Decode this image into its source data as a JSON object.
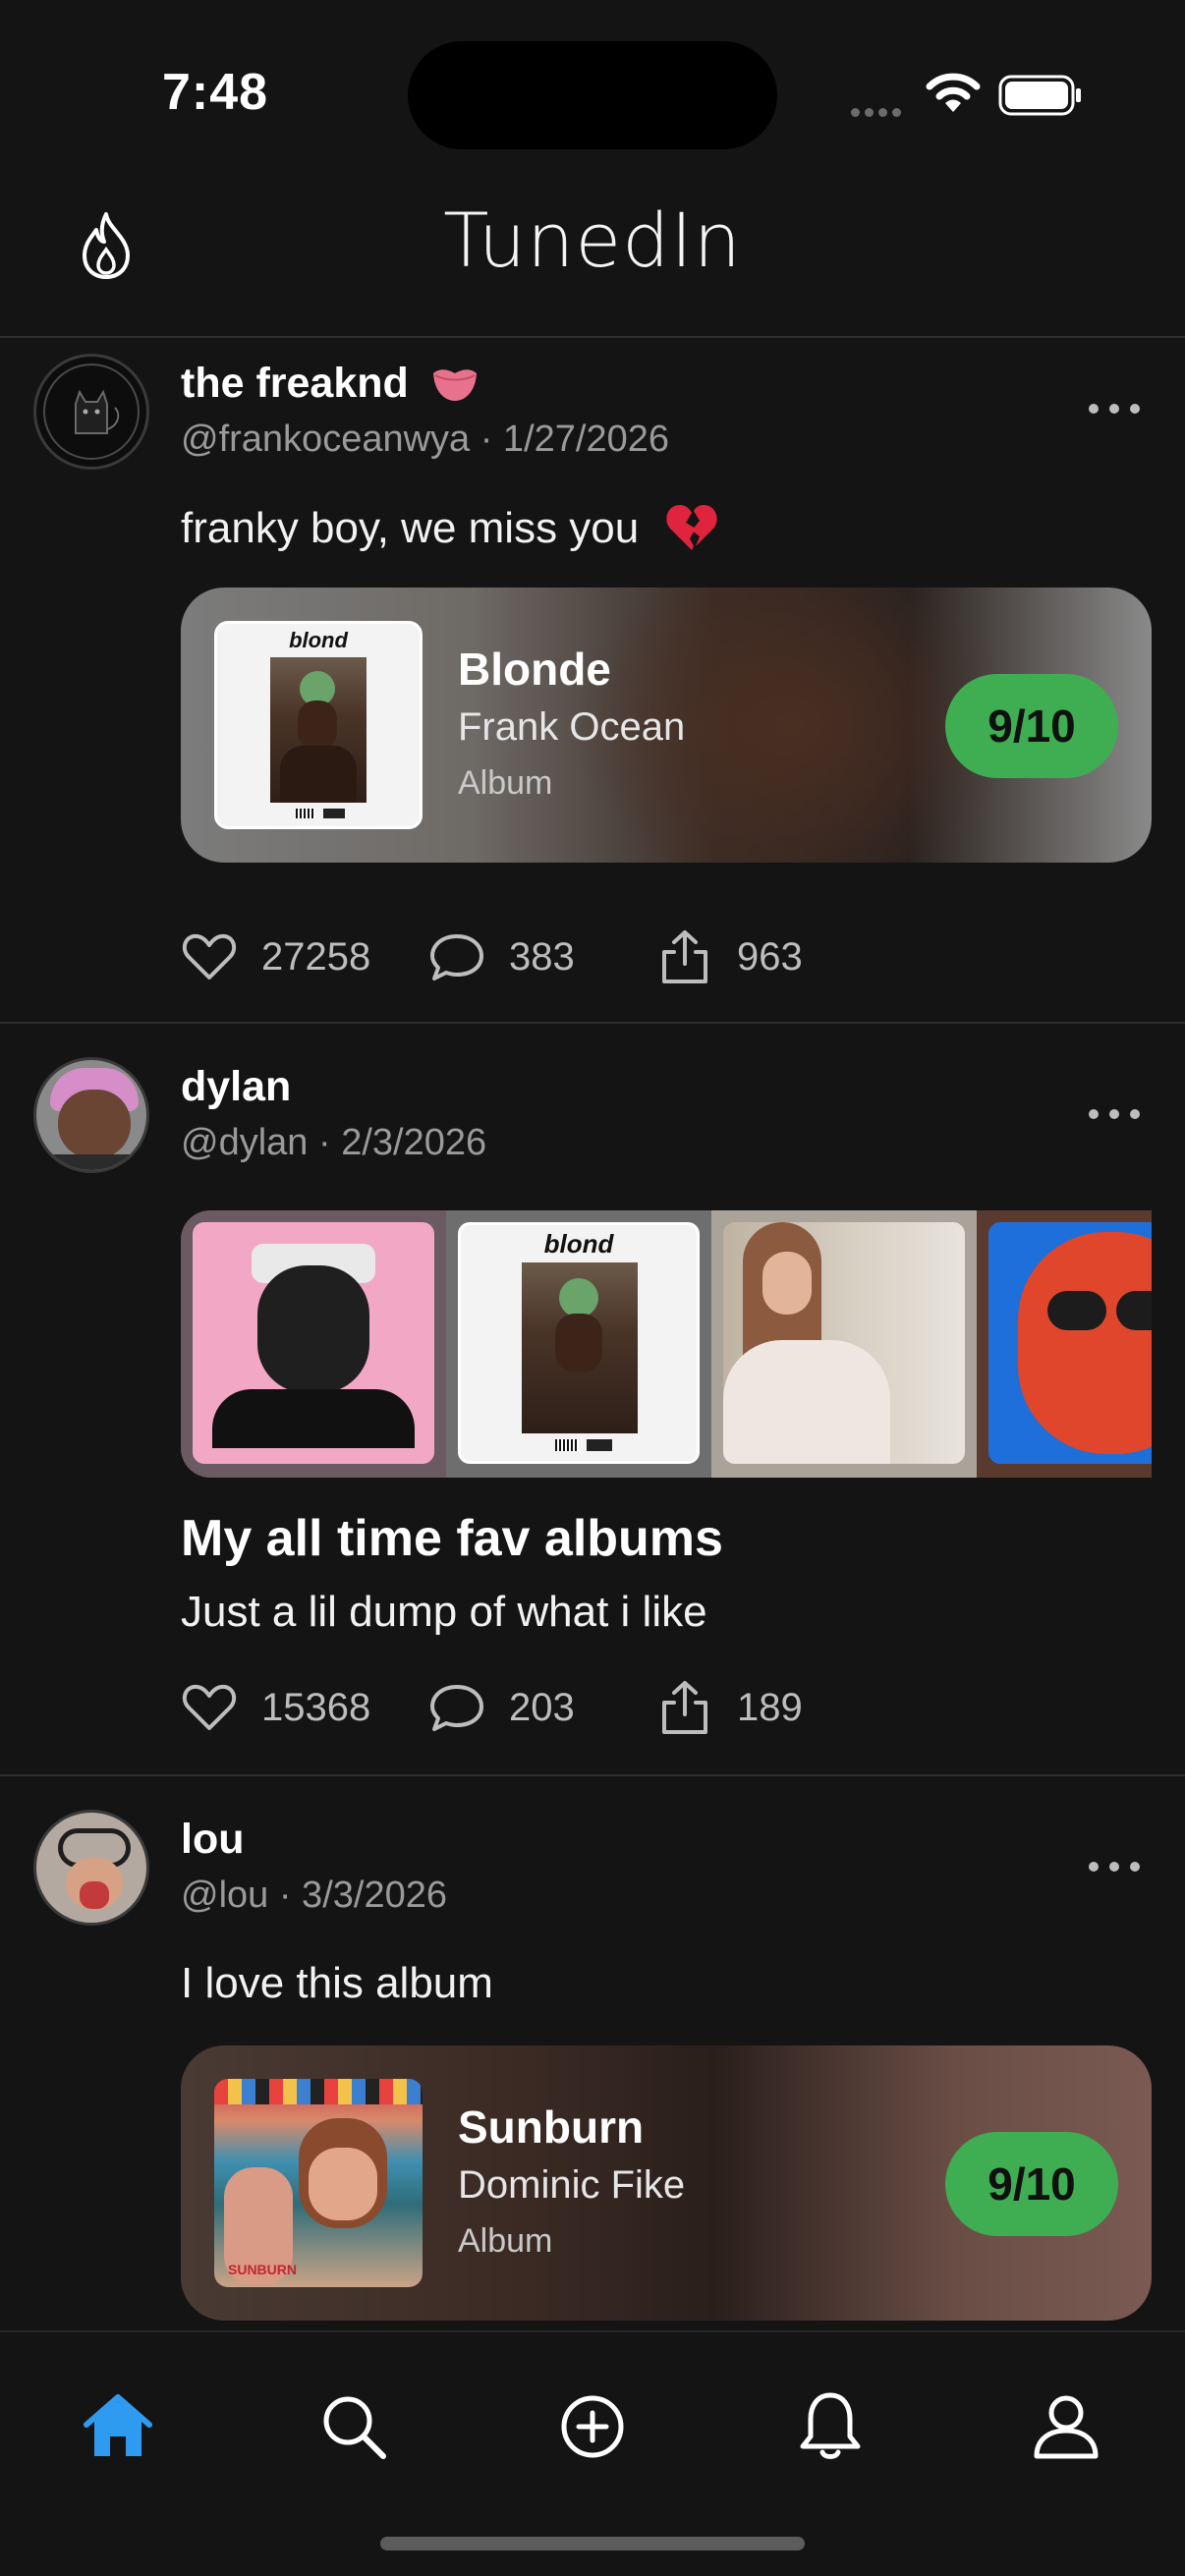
{
  "status": {
    "time": "7:48"
  },
  "header": {
    "title": "TunedIn"
  },
  "colors": {
    "accent": "#2f9bf0",
    "score": "#3fae52",
    "background": "#141414"
  },
  "posts": [
    {
      "name": "the freaknd",
      "handle": "@frankoceanwya",
      "date": "1/27/2026",
      "meta": "@frankoceanwya · 1/27/2026",
      "text": "franky boy, we miss you",
      "album": {
        "title": "Blonde",
        "artist": "Frank Ocean",
        "type": "Album",
        "score": "9/10",
        "cover_text": "blond"
      },
      "likes": "27258",
      "comments": "383",
      "shares": "963"
    },
    {
      "name": "dylan",
      "handle": "@dylan",
      "date": "2/3/2026",
      "meta": "@dylan · 2/3/2026",
      "list_title": "My all time fav albums",
      "text": "Just a lil dump of what i like",
      "collage_cover_text": "blond",
      "likes": "15368",
      "comments": "203",
      "shares": "189"
    },
    {
      "name": "lou",
      "handle": "@lou",
      "date": "3/3/2026",
      "meta": "@lou · 3/3/2026",
      "text": "I love this album",
      "album": {
        "title": "Sunburn",
        "artist": "Dominic Fike",
        "type": "Album",
        "score": "9/10"
      }
    }
  ],
  "tabs": [
    {
      "icon": "home-icon",
      "active": true
    },
    {
      "icon": "search-icon",
      "active": false
    },
    {
      "icon": "add-circle-icon",
      "active": false
    },
    {
      "icon": "bell-icon",
      "active": false
    },
    {
      "icon": "profile-icon",
      "active": false
    }
  ]
}
